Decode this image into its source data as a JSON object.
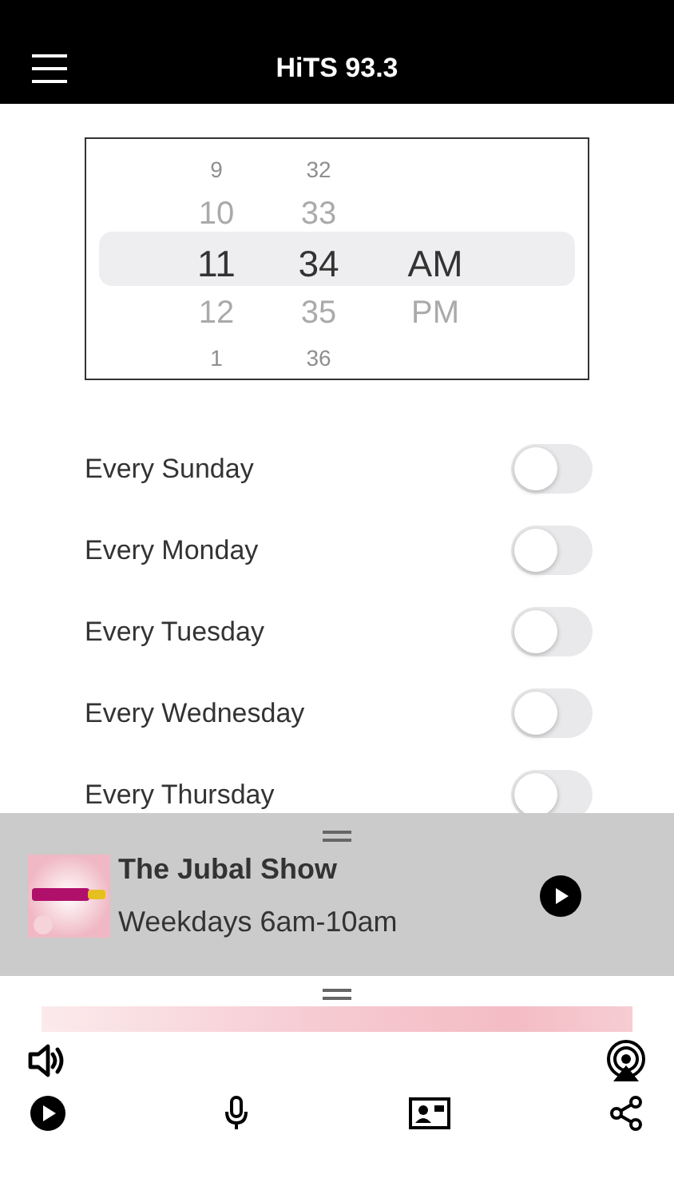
{
  "header": {
    "title": "HiTS 93.3"
  },
  "time_picker": {
    "columns": [
      {
        "items": [
          {
            "label": "9",
            "selected": false
          },
          {
            "label": "10",
            "selected": false
          },
          {
            "label": "11",
            "selected": true
          },
          {
            "label": "12",
            "selected": false
          },
          {
            "label": "1",
            "selected": false
          }
        ]
      },
      {
        "items": [
          {
            "label": "32",
            "selected": false
          },
          {
            "label": "33",
            "selected": false
          },
          {
            "label": "34",
            "selected": true
          },
          {
            "label": "35",
            "selected": false
          },
          {
            "label": "36",
            "selected": false
          }
        ]
      },
      {
        "items": [
          {
            "label": "AM",
            "selected": true
          },
          {
            "label": "PM",
            "selected": false
          }
        ]
      }
    ]
  },
  "repeat_days": [
    {
      "label": "Every Sunday",
      "on": false
    },
    {
      "label": "Every Monday",
      "on": false
    },
    {
      "label": "Every Tuesday",
      "on": false
    },
    {
      "label": "Every Wednesday",
      "on": false
    },
    {
      "label": "Every Thursday",
      "on": false
    }
  ],
  "now_playing": {
    "title": "The Jubal Show",
    "subtitle": "Weekdays 6am-10am"
  }
}
